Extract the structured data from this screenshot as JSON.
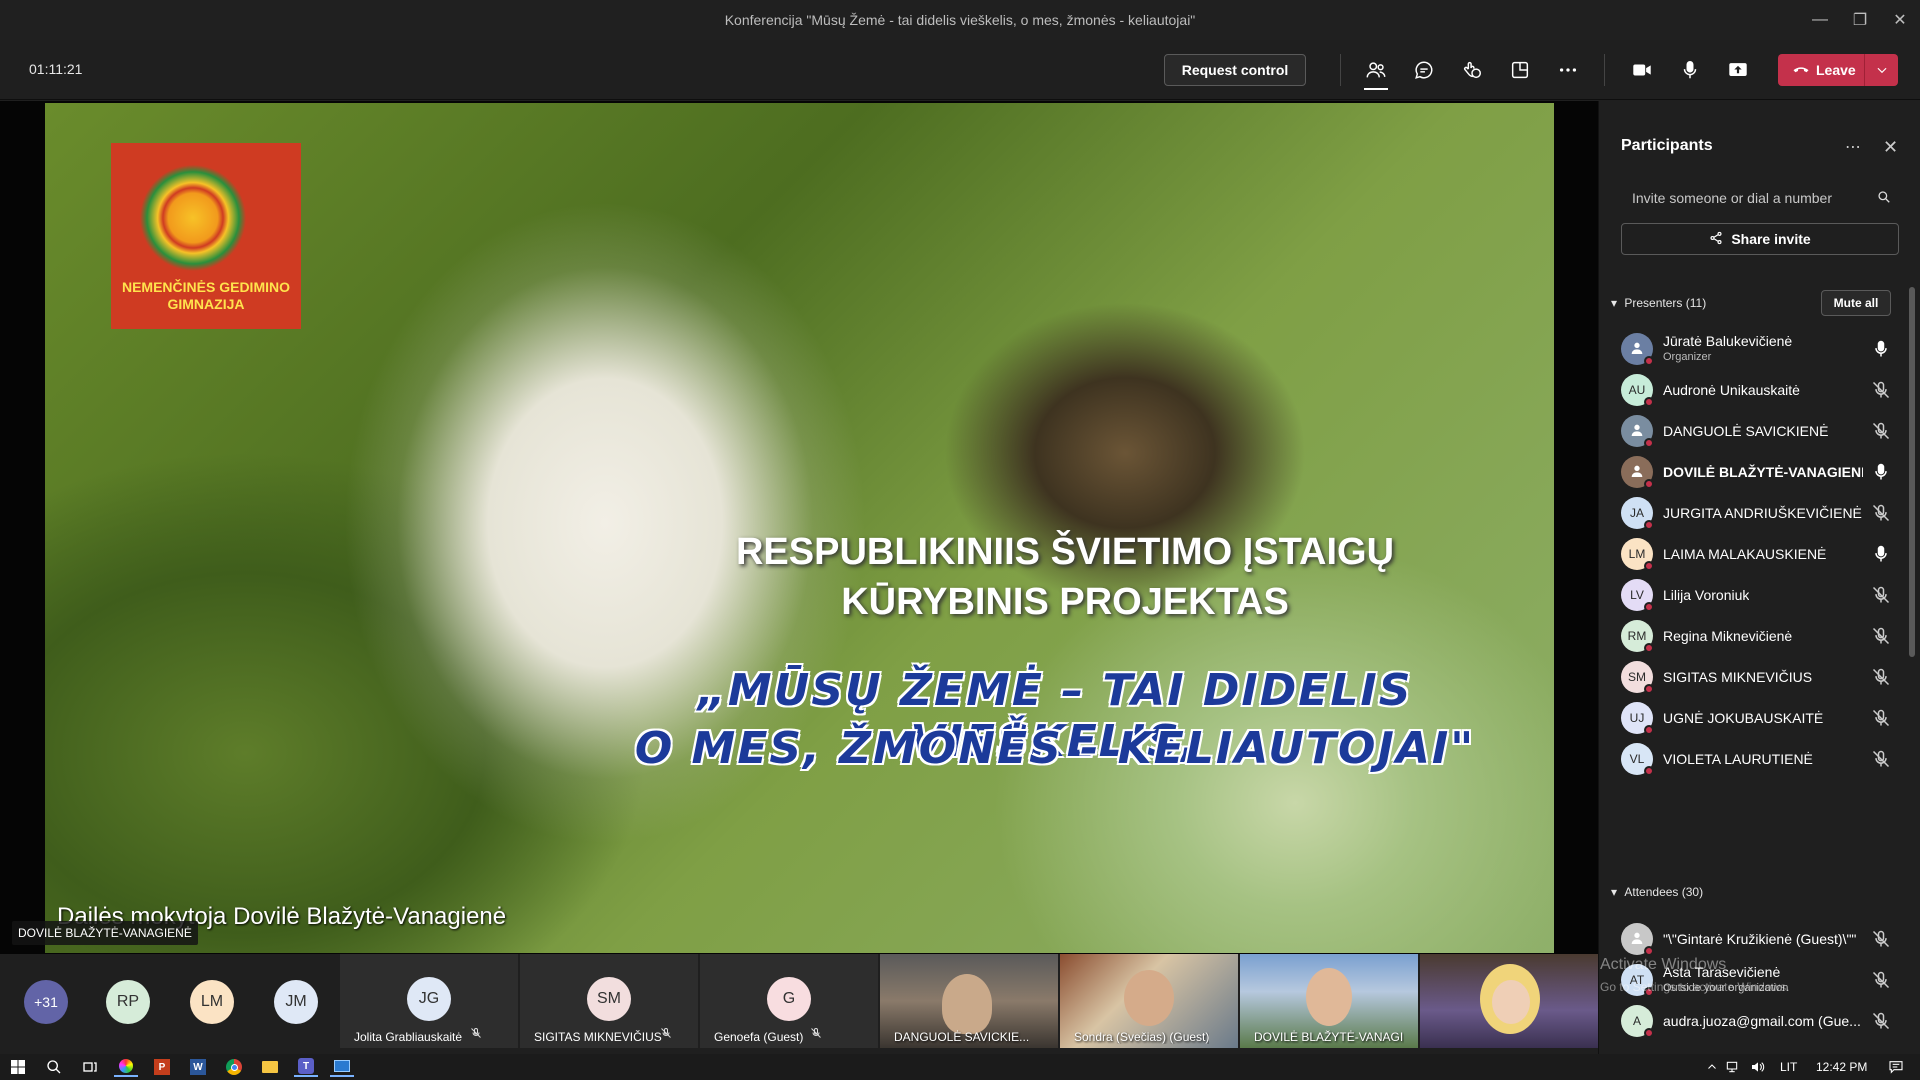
{
  "window": {
    "title": "Konferencija \"Mūsų Žemė - tai didelis vieškelis, o mes, žmonės - keliautojai\""
  },
  "toolbar": {
    "timer": "01:11:21",
    "request_control": "Request control",
    "leave": "Leave"
  },
  "slide": {
    "logo_text_1": "NEMENČINĖS GEDIMINO",
    "logo_text_2": "GIMNAZIJA",
    "line1": "RESPUBLIKINIIS ŠVIETIMO ĮSTAIGŲ",
    "line2": "KŪRYBINIS PROJEKTAS",
    "quote1": "„MŪSŲ ŽEMĖ – TAI DIDELIS VIEŠKELIS,",
    "quote2": "O MES,  ŽMONĖS - KELIAUTOJAI\"",
    "caption": "Dailės mokytoja Dovilė Blažytė-Vanagienė"
  },
  "speaker_label": "DOVILĖ BLAŽYTĖ-VANAGIENĖ",
  "participants": {
    "title": "Participants",
    "invite_placeholder": "Invite someone or dial a number",
    "share_invite": "Share invite",
    "presenters_label": "Presenters (11)",
    "mute_all": "Mute all",
    "presenters": [
      {
        "name": "Jūratė Balukevičienė",
        "role": "Organizer",
        "initials": "",
        "color": "#6b7fa3",
        "mic": "on"
      },
      {
        "name": "Audronė Unikauskaitė",
        "initials": "AU",
        "color": "#c7ecd9",
        "mic": "off"
      },
      {
        "name": "DANGUOLĖ SAVICKIENĖ",
        "initials": "",
        "color": "#7a8da0",
        "mic": "off"
      },
      {
        "name": "DOVILĖ BLAŽYTĖ-VANAGIENĖ",
        "initials": "",
        "color": "#8a6d5a",
        "mic": "on"
      },
      {
        "name": "JURGITA ANDRIUŠKEVIČIENĖ",
        "initials": "JA",
        "color": "#cfe0f4",
        "mic": "off"
      },
      {
        "name": "LAIMA MALAKAUSKIENĖ",
        "initials": "LM",
        "color": "#fbe3c4",
        "mic": "on"
      },
      {
        "name": "Lilija Voroniuk",
        "initials": "LV",
        "color": "#e4dcf6",
        "mic": "off"
      },
      {
        "name": "Regina Miknevičienė",
        "initials": "RM",
        "color": "#d6ecd9",
        "mic": "off"
      },
      {
        "name": "SIGITAS MIKNEVIČIUS",
        "initials": "SM",
        "color": "#f2dede",
        "mic": "off"
      },
      {
        "name": "UGNĖ JOKUBAUSKAITĖ",
        "initials": "UJ",
        "color": "#dfe4f8",
        "mic": "off"
      },
      {
        "name": "VIOLETA LAURUTIENĖ",
        "initials": "VL",
        "color": "#d8e6f6",
        "mic": "off"
      }
    ],
    "attendees_label": "Attendees (30)",
    "attendees": [
      {
        "name": "\"\\\"Gintarė Kružikienė (Guest)\\\"\"",
        "initials": "",
        "color": "#c8c8c8"
      },
      {
        "name": "Asta Tarasevičienė",
        "role": "Outside your organization",
        "initials": "AT",
        "color": "#cfe0f4"
      },
      {
        "name": "audra.juoza@gmail.com (Gue...",
        "initials": "A",
        "color": "#d6ecd9"
      }
    ]
  },
  "gallery": {
    "overflow": "+31",
    "bubbles": [
      {
        "initials": "RP",
        "color": "#d6ecd9"
      },
      {
        "initials": "LM",
        "color": "#fbe3c4"
      },
      {
        "initials": "JM",
        "color": "#dfe8f6"
      }
    ],
    "tiles": [
      {
        "initials": "JG",
        "name": "Jolita Grabliauskaitė",
        "color": "#dfe8f6"
      },
      {
        "initials": "SM",
        "name": "SIGITAS MIKNEVIČIUS",
        "color": "#f2dede"
      },
      {
        "initials": "G",
        "name": "Genoefa (Guest)",
        "color": "#f8dde0"
      }
    ],
    "video_tiles": [
      {
        "name": "DANGUOLĖ SAVICKIE..."
      },
      {
        "name": "Sondra (Svečias) (Guest)"
      },
      {
        "name": "DOVILĖ BLAŽYTĖ-VANAGI..."
      },
      {
        "name": ""
      }
    ]
  },
  "watermark": {
    "line1": "Activate Windows",
    "line2": "Go to Settings to activate Windows."
  },
  "taskbar": {
    "lang": "LIT",
    "clock": "12:42 PM"
  }
}
